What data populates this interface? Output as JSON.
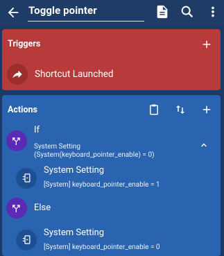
{
  "appbar": {
    "title": "Toggle pointer",
    "icons": [
      "back-arrow-icon",
      "document-icon",
      "search-icon",
      "more-vertical-icon"
    ]
  },
  "triggers": {
    "title": "Triggers",
    "items": [
      {
        "label": "Shortcut Launched",
        "icon": "share-arrow-icon"
      }
    ]
  },
  "actions": {
    "title": "Actions",
    "header_icons": [
      "clipboard-icon",
      "sort-icon",
      "add-icon"
    ],
    "items": [
      {
        "type": "if",
        "label": "If",
        "detail_line1": "System Setting",
        "detail_line2": "(System(keyboard_pointer_enable) = 0)",
        "icon": "branch-icon"
      },
      {
        "type": "action",
        "label": "System Setting",
        "detail": "[System] keyboard_pointer_enable = 1",
        "icon": "settings-device-icon"
      },
      {
        "type": "else",
        "label": "Else",
        "icon": "branch-icon"
      },
      {
        "type": "action",
        "label": "System Setting",
        "detail": "[System] keyboard_pointer_enable = 0",
        "icon": "settings-device-icon"
      }
    ]
  },
  "colors": {
    "appbar": "#1e3c66",
    "triggers_card": "#b83b3b",
    "actions_card": "#2a64b0",
    "branch_icon_bg": "#5b2bb5"
  }
}
